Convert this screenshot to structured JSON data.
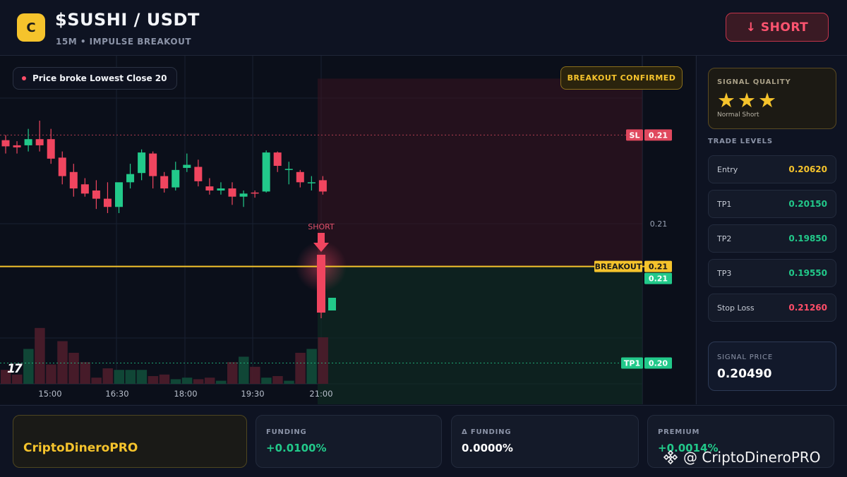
{
  "header": {
    "logo_letter": "C",
    "pair": "$SUSHI / USDT",
    "subtitle": "15M • IMPULSE BREAKOUT",
    "short_label": "↓ SHORT"
  },
  "chart": {
    "badge_broke": "Price broke Lowest Close 20",
    "badge_confirm": "BREAKOUT CONFIRMED",
    "tv_logo": "17",
    "short_marker": "SHORT",
    "price_axis_label": "0.21",
    "time_labels": [
      "15:00",
      "16:30",
      "18:00",
      "19:30",
      "21:00"
    ],
    "level_tags": {
      "sl": {
        "name": "SL",
        "value": "0.21"
      },
      "breakout": {
        "name": "BREAKOUT",
        "value": "0.21"
      },
      "last": {
        "value": "0.21"
      },
      "tp1": {
        "name": "TP1",
        "value": "0.20"
      }
    },
    "colors": {
      "up": "#22c98a",
      "down": "#f0455f",
      "breakout": "#f5c32c"
    }
  },
  "chart_data": {
    "type": "candlestick",
    "x": [
      "14:30",
      "14:45",
      "15:00",
      "15:15",
      "15:30",
      "15:45",
      "16:00",
      "16:15",
      "16:30",
      "16:45",
      "17:00",
      "17:15",
      "17:30",
      "17:45",
      "18:00",
      "18:15",
      "18:30",
      "18:45",
      "19:00",
      "19:15",
      "19:30",
      "19:45",
      "20:00",
      "20:15",
      "20:30",
      "20:45",
      "21:00",
      "21:15",
      "21:30"
    ],
    "candles": [
      {
        "o": 0.21235,
        "h": 0.2126,
        "l": 0.2117,
        "c": 0.21205
      },
      {
        "o": 0.2121,
        "h": 0.2123,
        "l": 0.2117,
        "c": 0.212
      },
      {
        "o": 0.2121,
        "h": 0.2129,
        "l": 0.2118,
        "c": 0.2124
      },
      {
        "o": 0.2124,
        "h": 0.2133,
        "l": 0.2118,
        "c": 0.2121
      },
      {
        "o": 0.2124,
        "h": 0.2129,
        "l": 0.2112,
        "c": 0.21145
      },
      {
        "o": 0.2115,
        "h": 0.2118,
        "l": 0.2102,
        "c": 0.2106
      },
      {
        "o": 0.2108,
        "h": 0.2112,
        "l": 0.2096,
        "c": 0.21
      },
      {
        "o": 0.2102,
        "h": 0.2105,
        "l": 0.2096,
        "c": 0.20975
      },
      {
        "o": 0.2099,
        "h": 0.2104,
        "l": 0.209,
        "c": 0.2095
      },
      {
        "o": 0.2095,
        "h": 0.2103,
        "l": 0.2088,
        "c": 0.2091
      },
      {
        "o": 0.2091,
        "h": 0.2101,
        "l": 0.2088,
        "c": 0.2103
      },
      {
        "o": 0.2103,
        "h": 0.2112,
        "l": 0.21,
        "c": 0.2107
      },
      {
        "o": 0.21075,
        "h": 0.2119,
        "l": 0.2104,
        "c": 0.21175
      },
      {
        "o": 0.2117,
        "h": 0.2118,
        "l": 0.21,
        "c": 0.2106
      },
      {
        "o": 0.2106,
        "h": 0.2108,
        "l": 0.2098,
        "c": 0.21
      },
      {
        "o": 0.21005,
        "h": 0.2113,
        "l": 0.2099,
        "c": 0.2109
      },
      {
        "o": 0.211,
        "h": 0.2117,
        "l": 0.2108,
        "c": 0.21115
      },
      {
        "o": 0.21105,
        "h": 0.2114,
        "l": 0.2101,
        "c": 0.21035
      },
      {
        "o": 0.2101,
        "h": 0.2105,
        "l": 0.2097,
        "c": 0.2099
      },
      {
        "o": 0.2099,
        "h": 0.2103,
        "l": 0.2097,
        "c": 0.21
      },
      {
        "o": 0.21,
        "h": 0.2103,
        "l": 0.2092,
        "c": 0.2096
      },
      {
        "o": 0.2096,
        "h": 0.2099,
        "l": 0.2091,
        "c": 0.20975
      },
      {
        "o": 0.2098,
        "h": 0.2099,
        "l": 0.20955,
        "c": 0.20975
      },
      {
        "o": 0.20985,
        "h": 0.21185,
        "l": 0.2098,
        "c": 0.21175
      },
      {
        "o": 0.21175,
        "h": 0.2118,
        "l": 0.2108,
        "c": 0.2111
      },
      {
        "o": 0.2109,
        "h": 0.2113,
        "l": 0.2102,
        "c": 0.21095
      },
      {
        "o": 0.2108,
        "h": 0.2109,
        "l": 0.21005,
        "c": 0.2103
      },
      {
        "o": 0.2103,
        "h": 0.2106,
        "l": 0.2099,
        "c": 0.2103
      },
      {
        "o": 0.2104,
        "h": 0.2106,
        "l": 0.2097,
        "c": 0.20985
      }
    ],
    "volumes": [
      0.18,
      0.12,
      0.45,
      0.72,
      0.25,
      0.55,
      0.4,
      0.28,
      0.08,
      0.2,
      0.18,
      0.18,
      0.18,
      0.1,
      0.12,
      0.06,
      0.08,
      0.06,
      0.08,
      0.04,
      0.28,
      0.35,
      0.22,
      0.08,
      0.1,
      0.04,
      0.4,
      0.45,
      0.6
    ],
    "levels": {
      "sl": 0.2126,
      "breakout": 0.2062,
      "tp1": 0.2015
    }
  },
  "sidebar": {
    "quality_title": "SIGNAL QUALITY",
    "stars": "★★★",
    "quality_sub": "Normal Short",
    "levels_title": "TRADE LEVELS",
    "levels": [
      {
        "name": "Entry",
        "value": "0.20620",
        "color": "#f5c32c"
      },
      {
        "name": "TP1",
        "value": "0.20150",
        "color": "#22c98a"
      },
      {
        "name": "TP2",
        "value": "0.19850",
        "color": "#22c98a"
      },
      {
        "name": "TP3",
        "value": "0.19550",
        "color": "#22c98a"
      },
      {
        "name": "Stop Loss",
        "value": "0.21260",
        "color": "#ff4d68"
      }
    ],
    "signal_price_title": "SIGNAL PRICE",
    "signal_price": "0.20490"
  },
  "footer": {
    "brand": "CriptoDineroPRO",
    "cards": [
      {
        "title": "FUNDING",
        "value": "+0.0100%",
        "color": "#22c98a"
      },
      {
        "title": "Δ FUNDING",
        "value": "0.0000%",
        "color": "#ffffff"
      },
      {
        "title": "PREMIUM",
        "value": "+0.0014%",
        "color": "#22c98a"
      }
    ],
    "watermark": "@ CriptoDineroPRO"
  }
}
